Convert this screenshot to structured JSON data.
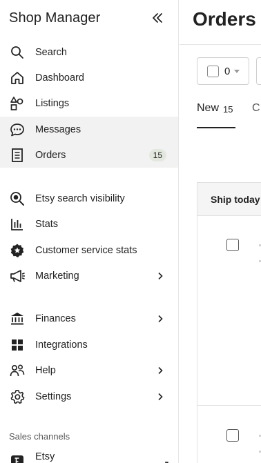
{
  "sidebar": {
    "title": "Shop Manager",
    "items": [
      {
        "label": "Search",
        "icon": "search-icon"
      },
      {
        "label": "Dashboard",
        "icon": "home-icon"
      },
      {
        "label": "Listings",
        "icon": "shapes-icon"
      },
      {
        "label": "Messages",
        "icon": "chat-bubble-icon"
      },
      {
        "label": "Orders",
        "icon": "receipt-icon",
        "badge": "15"
      },
      {
        "label": "Etsy search visibility",
        "icon": "magnifier-icon"
      },
      {
        "label": "Stats",
        "icon": "bar-chart-icon"
      },
      {
        "label": "Customer service stats",
        "icon": "star-badge-icon"
      },
      {
        "label": "Marketing",
        "icon": "megaphone-icon"
      },
      {
        "label": "Finances",
        "icon": "bank-icon"
      },
      {
        "label": "Integrations",
        "icon": "grid-icon"
      },
      {
        "label": "Help",
        "icon": "people-icon"
      },
      {
        "label": "Settings",
        "icon": "gear-icon"
      }
    ],
    "sales_channels_label": "Sales channels",
    "channel": {
      "label": "Etsy",
      "icon": "etsy-icon"
    }
  },
  "main": {
    "title": "Orders",
    "select_count": "0",
    "tabs": [
      {
        "label": "New",
        "count": "15"
      },
      {
        "label": "C"
      }
    ],
    "table_header": "Ship today"
  }
}
